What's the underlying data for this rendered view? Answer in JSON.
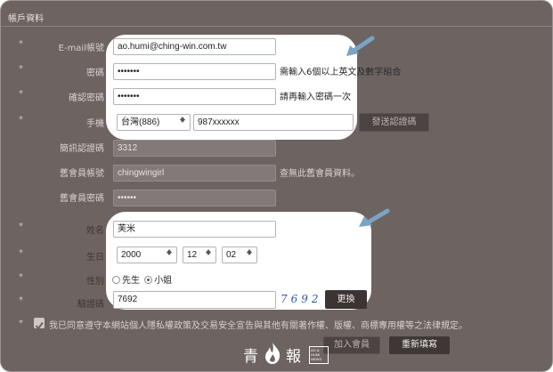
{
  "section_title": "帳戶資料",
  "form": {
    "email_label": "E-mail帳號",
    "email_value": "ao.humi@ching-win.com.tw",
    "password_label": "密碼",
    "password_value": "•••••••",
    "password_hint": "需輸入6個以上英文及數字組合",
    "confirm_label": "確認密碼",
    "confirm_value": "•••••••",
    "confirm_hint": "請再輸入密碼一次",
    "phone_label": "手機",
    "phone_country": "台灣(886)",
    "phone_value": "987xxxxxx",
    "send_code_button": "發送認證碼",
    "sms_code_label": "簡訊認證碼",
    "sms_code_value": "3312",
    "old_account_label": "舊會員帳號",
    "old_account_value": "chingwingirl",
    "old_account_hint": "查無此舊會員資料。",
    "old_password_label": "舊會員密碼",
    "old_password_value": "••••••",
    "name_label": "姓名",
    "name_value": "芙米",
    "birthday_label": "生日",
    "birth_year": "2000",
    "birth_month": "12",
    "birth_day": "02",
    "gender_label": "性別",
    "gender_male": "先生",
    "gender_female": "小姐",
    "captcha_label": "驗證碼",
    "captcha_value": "7692",
    "captcha_image_text": "7692",
    "refresh_button": "更換",
    "consent_text": "我已同意遵守本網站個人隱私權政策及交易安全宣告與其他有關著作權、版權、商標專用權等之法律規定。",
    "join_button": "加入會員",
    "reset_button": "重新填寫"
  },
  "bullets": "*",
  "watermark": {
    "char1": "青",
    "char3": "報",
    "small_text": "AO & HUMI NEWS"
  },
  "colors": {
    "overlay": "#6d6462",
    "highlight": "#ffffff",
    "arrow": "#7aa3c4",
    "captcha": "#2a5aa8"
  }
}
